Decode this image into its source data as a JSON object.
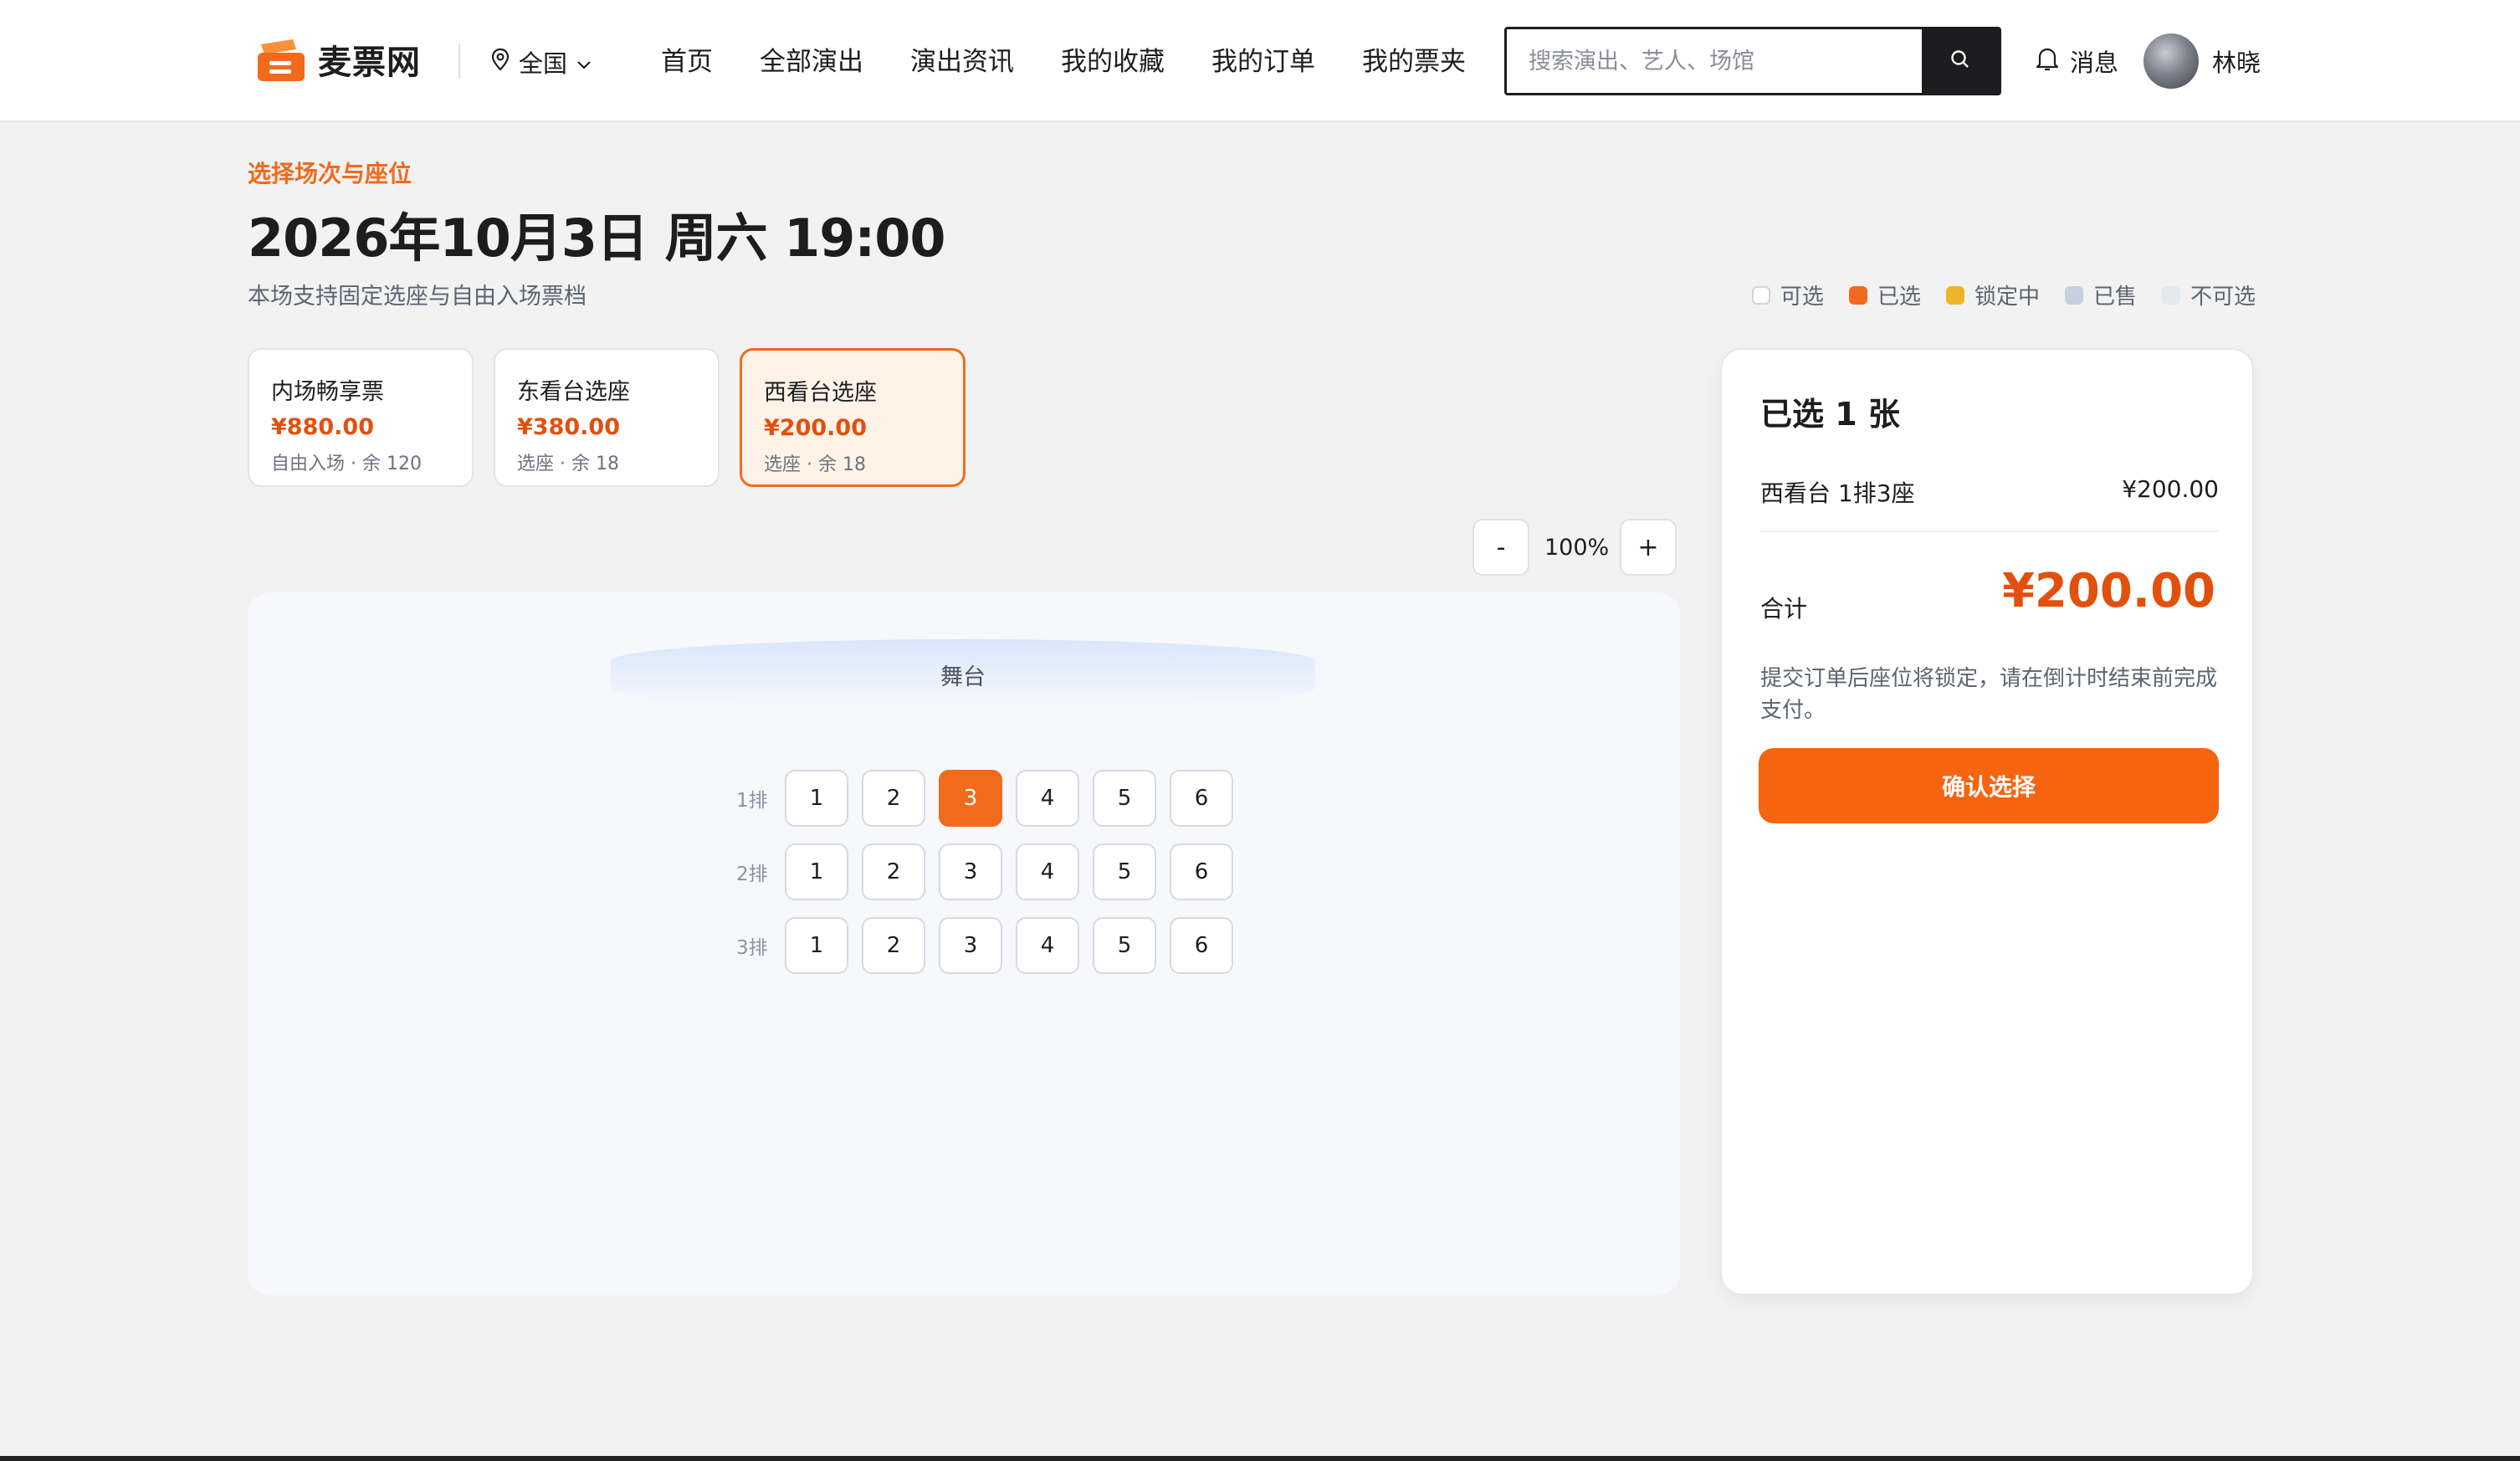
{
  "brand": {
    "name": "麦票网",
    "color": "#f26a1b"
  },
  "header": {
    "city": "全国",
    "nav": [
      "首页",
      "全部演出",
      "演出资讯",
      "我的收藏",
      "我的订单",
      "我的票夹"
    ],
    "search_placeholder": "搜索演出、艺人、场馆",
    "messages_label": "消息",
    "user_name": "林晓"
  },
  "page": {
    "eyebrow": "选择场次与座位",
    "title": "2026年10月3日 周六 19:00",
    "subtitle": "本场支持固定选座与自由入场票档"
  },
  "legend": [
    {
      "label": "可选",
      "color": "#ffffff"
    },
    {
      "label": "已选",
      "color": "#f26a1b"
    },
    {
      "label": "锁定中",
      "color": "#f0b429"
    },
    {
      "label": "已售",
      "color": "#c7d0de"
    },
    {
      "label": "不可选",
      "color": "#e4e8ef"
    }
  ],
  "tiers": [
    {
      "name": "内场畅享票",
      "price": "¥880.00",
      "meta": "自由入场 · 余 120"
    },
    {
      "name": "东看台选座",
      "price": "¥380.00",
      "meta": "选座 · 余 18"
    },
    {
      "name": "西看台选座",
      "price": "¥200.00",
      "meta": "选座 · 余 18",
      "active": true
    }
  ],
  "zoom": {
    "minus": "-",
    "value": "100%",
    "plus": "+"
  },
  "seatmap": {
    "stage_label": "舞台",
    "rows": [
      {
        "label": "1排",
        "seats": [
          "1",
          "2",
          "3",
          "4",
          "5",
          "6"
        ],
        "selected": [
          "3"
        ]
      },
      {
        "label": "2排",
        "seats": [
          "1",
          "2",
          "3",
          "4",
          "5",
          "6"
        ],
        "selected": []
      },
      {
        "label": "3排",
        "seats": [
          "1",
          "2",
          "3",
          "4",
          "5",
          "6"
        ],
        "selected": []
      }
    ]
  },
  "summary": {
    "title": "已选 1 张",
    "items": [
      {
        "label": "西看台 1排3座",
        "price": "¥200.00"
      }
    ],
    "total_label": "合计",
    "total_value": "¥200.00",
    "note": "提交订单后座位将锁定，请在倒计时结束前完成支付。",
    "confirm_label": "确认选择"
  }
}
